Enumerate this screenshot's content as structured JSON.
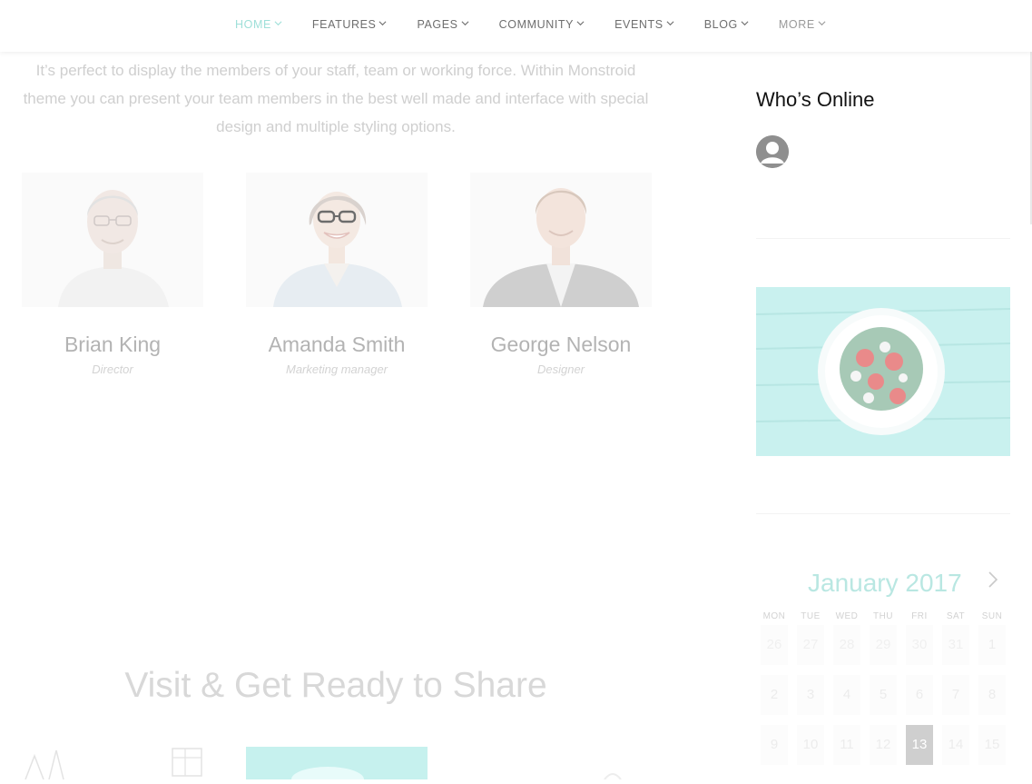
{
  "nav": {
    "items": [
      {
        "label": "HOME",
        "active": true
      },
      {
        "label": "FEATURES",
        "active": false
      },
      {
        "label": "PAGES",
        "active": false
      },
      {
        "label": "COMMUNITY",
        "active": false
      },
      {
        "label": "EVENTS",
        "active": false
      },
      {
        "label": "BLOG",
        "active": false
      },
      {
        "label": "MORE",
        "active": false
      }
    ]
  },
  "intro": {
    "text": "It’s perfect to display the members of your staff, team or working force. Within Monstroid theme you can present your team members in the best well made and interface with special design and multiple styling options."
  },
  "team": [
    {
      "name": "Brian King",
      "role": "Director"
    },
    {
      "name": "Amanda Smith",
      "role": "Marketing manager"
    },
    {
      "name": "George Nelson",
      "role": "Designer"
    }
  ],
  "share": {
    "title": "Visit & Get Ready to Share"
  },
  "sidebar": {
    "online_title": "Who’s Online"
  },
  "calendar": {
    "month": "January 2017",
    "weekdays": [
      "MON",
      "TUE",
      "WED",
      "THU",
      "FRI",
      "SAT",
      "SUN"
    ],
    "rows": [
      [
        "26",
        "27",
        "28",
        "29",
        "30",
        "31",
        "1"
      ],
      [
        "2",
        "3",
        "4",
        "5",
        "6",
        "7",
        "8"
      ],
      [
        "9",
        "10",
        "11",
        "12",
        "13",
        "14",
        "15"
      ]
    ],
    "today": "13"
  },
  "colors": {
    "accent": "#9fe0d9",
    "nav_text": "#6e6e6e",
    "food_bg": "#c9f1ef"
  }
}
